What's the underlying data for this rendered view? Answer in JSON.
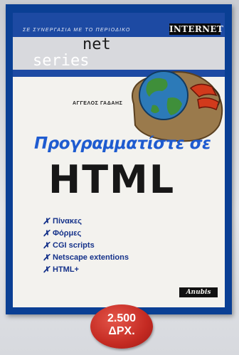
{
  "tagline": "ΣΕ ΣΥΝΕΡΓΑΣΙΑ ΜΕ ΤΟ ΠΕΡΙΟΔΙΚΟ",
  "internet_logo": "INTERNET",
  "series": {
    "line1": "net",
    "line2": "series"
  },
  "author": "ΑΓΓΕΛΟΣ ΓΑΔΑΗΣ",
  "title": {
    "line1": "Προγραμματίστε σε",
    "line2": "HTML"
  },
  "features": [
    {
      "mark": "✗",
      "label": "Πίνακες"
    },
    {
      "mark": "✗",
      "label": "Φόρμες"
    },
    {
      "mark": "✗",
      "label": "CGI scripts"
    },
    {
      "mark": "✗",
      "label": "Netscape extentions"
    },
    {
      "mark": "✗",
      "label": "HTML+"
    }
  ],
  "publisher_logo": "Anubis",
  "price": {
    "amount": "2.500",
    "currency": "ΔΡΧ."
  },
  "colors": {
    "cover_blue": "#0a3f94",
    "title_blue": "#1e5bd0",
    "price_red": "#c42a22",
    "phone_red": "#d23a1c"
  },
  "icons": [
    "globe-icon",
    "telephone-icon"
  ]
}
